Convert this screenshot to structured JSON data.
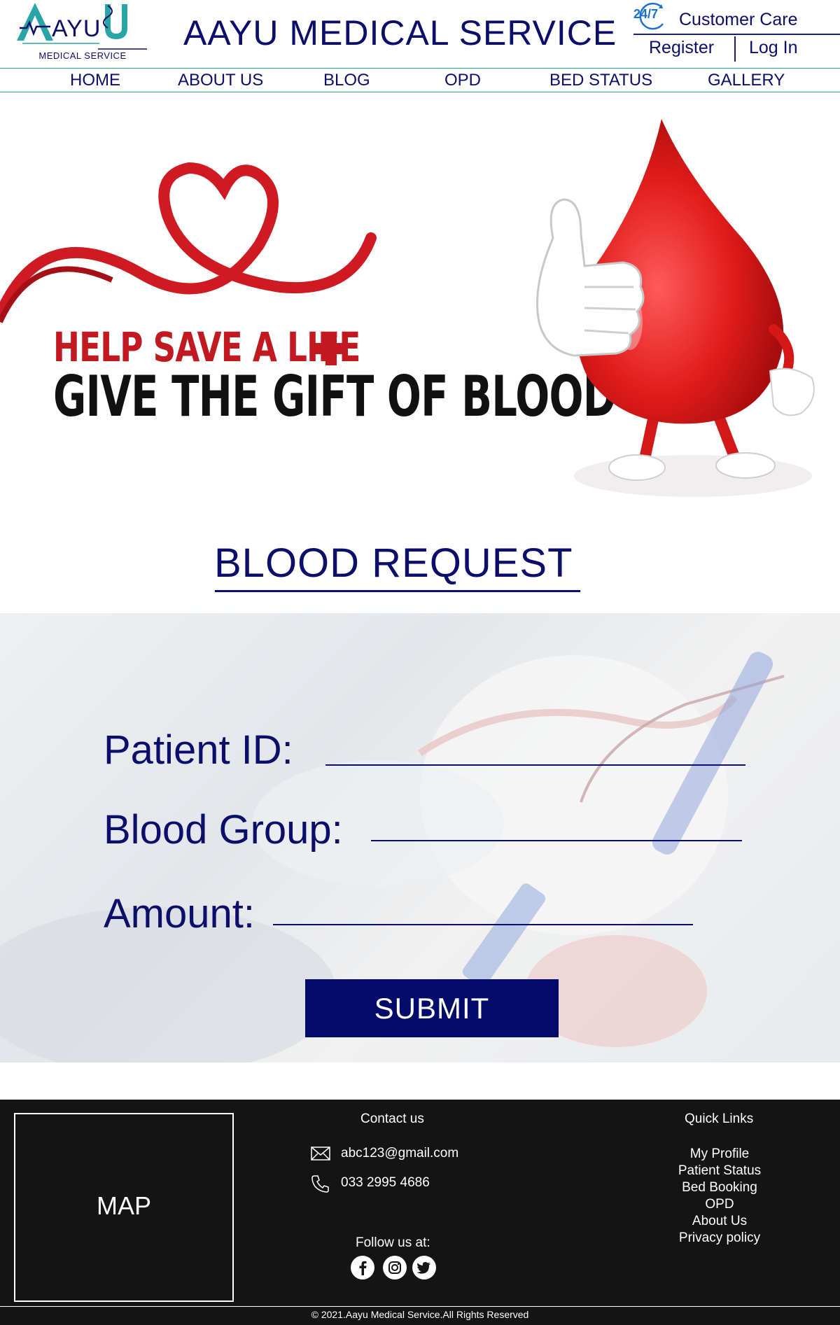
{
  "header": {
    "logo_text": "AYU",
    "logo_subtitle": "MEDICAL SERVICE",
    "site_title": "AAYU MEDICAL SERVICE",
    "care_badge": "24/7",
    "customer_care": "Customer Care",
    "register": "Register",
    "login": "Log In"
  },
  "nav": {
    "items": [
      "HOME",
      "ABOUT US",
      "BLOG",
      "OPD",
      "BED STATUS",
      "GALLERY"
    ]
  },
  "hero": {
    "line1": "HELP SAVE A LIFE",
    "line2": "GIVE THE GIFT OF BLOOD"
  },
  "form": {
    "title": "BLOOD REQUEST",
    "patient_id_label": "Patient ID:",
    "patient_id_value": "",
    "blood_group_label": "Blood Group:",
    "blood_group_value": "",
    "amount_label": "Amount:",
    "amount_value": "",
    "submit": "SUBMIT"
  },
  "footer": {
    "map_label": "MAP",
    "contact_title": "Contact us",
    "email": "abc123@gmail.com",
    "phone": "033 2995 4686",
    "follow_title": "Follow us at:",
    "social_icons": [
      "facebook-icon",
      "instagram-icon",
      "twitter-icon"
    ],
    "quick_links_title": "Quick Links",
    "quick_links": [
      "My Profile",
      "Patient Status",
      "Bed Booking",
      "OPD",
      "About Us",
      "Privacy policy"
    ],
    "copyright": "© 2021.Aayu Medical Service.All Rights Reserved"
  },
  "colors": {
    "brand_navy": "#0b0f6b",
    "accent_teal": "#2aa5a5",
    "submit_bg": "#020a6a",
    "blood_red": "#c21820",
    "footer_bg": "#141414"
  }
}
